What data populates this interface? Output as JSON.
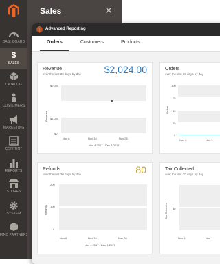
{
  "sidebar": {
    "items": [
      {
        "label": "DASHBOARD",
        "icon": "dashboard-icon"
      },
      {
        "label": "SALES",
        "icon": "dollar-icon"
      },
      {
        "label": "CATALOG",
        "icon": "cube-icon"
      },
      {
        "label": "CUSTOMERS",
        "icon": "person-icon"
      },
      {
        "label": "MARKETING",
        "icon": "megaphone-icon"
      },
      {
        "label": "CONTENT",
        "icon": "content-icon"
      },
      {
        "label": "REPORTS",
        "icon": "bar-chart-icon"
      },
      {
        "label": "STORES",
        "icon": "store-icon"
      },
      {
        "label": "SYSTEM",
        "icon": "gear-icon"
      },
      {
        "label": "FIND PARTNERS",
        "icon": "partners-icon"
      }
    ],
    "active_index": 1
  },
  "sales_panel": {
    "title": "Sales"
  },
  "report_window": {
    "title": "Advanced Reporting",
    "tabs": [
      {
        "label": "Orders"
      },
      {
        "label": "Customers"
      },
      {
        "label": "Products"
      }
    ]
  },
  "cards": {
    "revenue": {
      "title": "Revenue",
      "subtitle": "over the last 30 days by day",
      "value": "$2,024.00",
      "value_color": "#2a7bbf",
      "y_ticks": [
        "$2,000",
        "$1,000",
        "$0"
      ],
      "y_title": "Revenue",
      "x_ticks": [
        "Nov 6",
        "Nov 16",
        "Nov 26"
      ],
      "caption": "Nov 4 2017 - Dec 3 2017"
    },
    "orders": {
      "title": "Orders",
      "subtitle": "over the last 30 days by day",
      "y_ticks": [
        "100",
        "75",
        "50",
        "25",
        "0"
      ],
      "y_title": "Orders",
      "x_ticks": [
        "Nov 6",
        "Nov 1"
      ]
    },
    "refunds": {
      "title": "Refunds",
      "subtitle": "over the last 30 days by day",
      "value": "80",
      "value_color": "#c9a227",
      "y_ticks": [
        "200",
        "100",
        "0"
      ],
      "y_title": "Refunds",
      "x_ticks": [
        "Nov 6",
        "Nov 16",
        "Nov 26"
      ],
      "caption": "Nov 4 2017 - Dec 3 2017"
    },
    "tax": {
      "title": "Tax Collected",
      "subtitle": "over the last 30 days by day",
      "y_ticks": [
        "$0"
      ],
      "y_title": "Tax Collected",
      "x_ticks": [
        "Nov 6",
        "Nov 1"
      ]
    }
  }
}
